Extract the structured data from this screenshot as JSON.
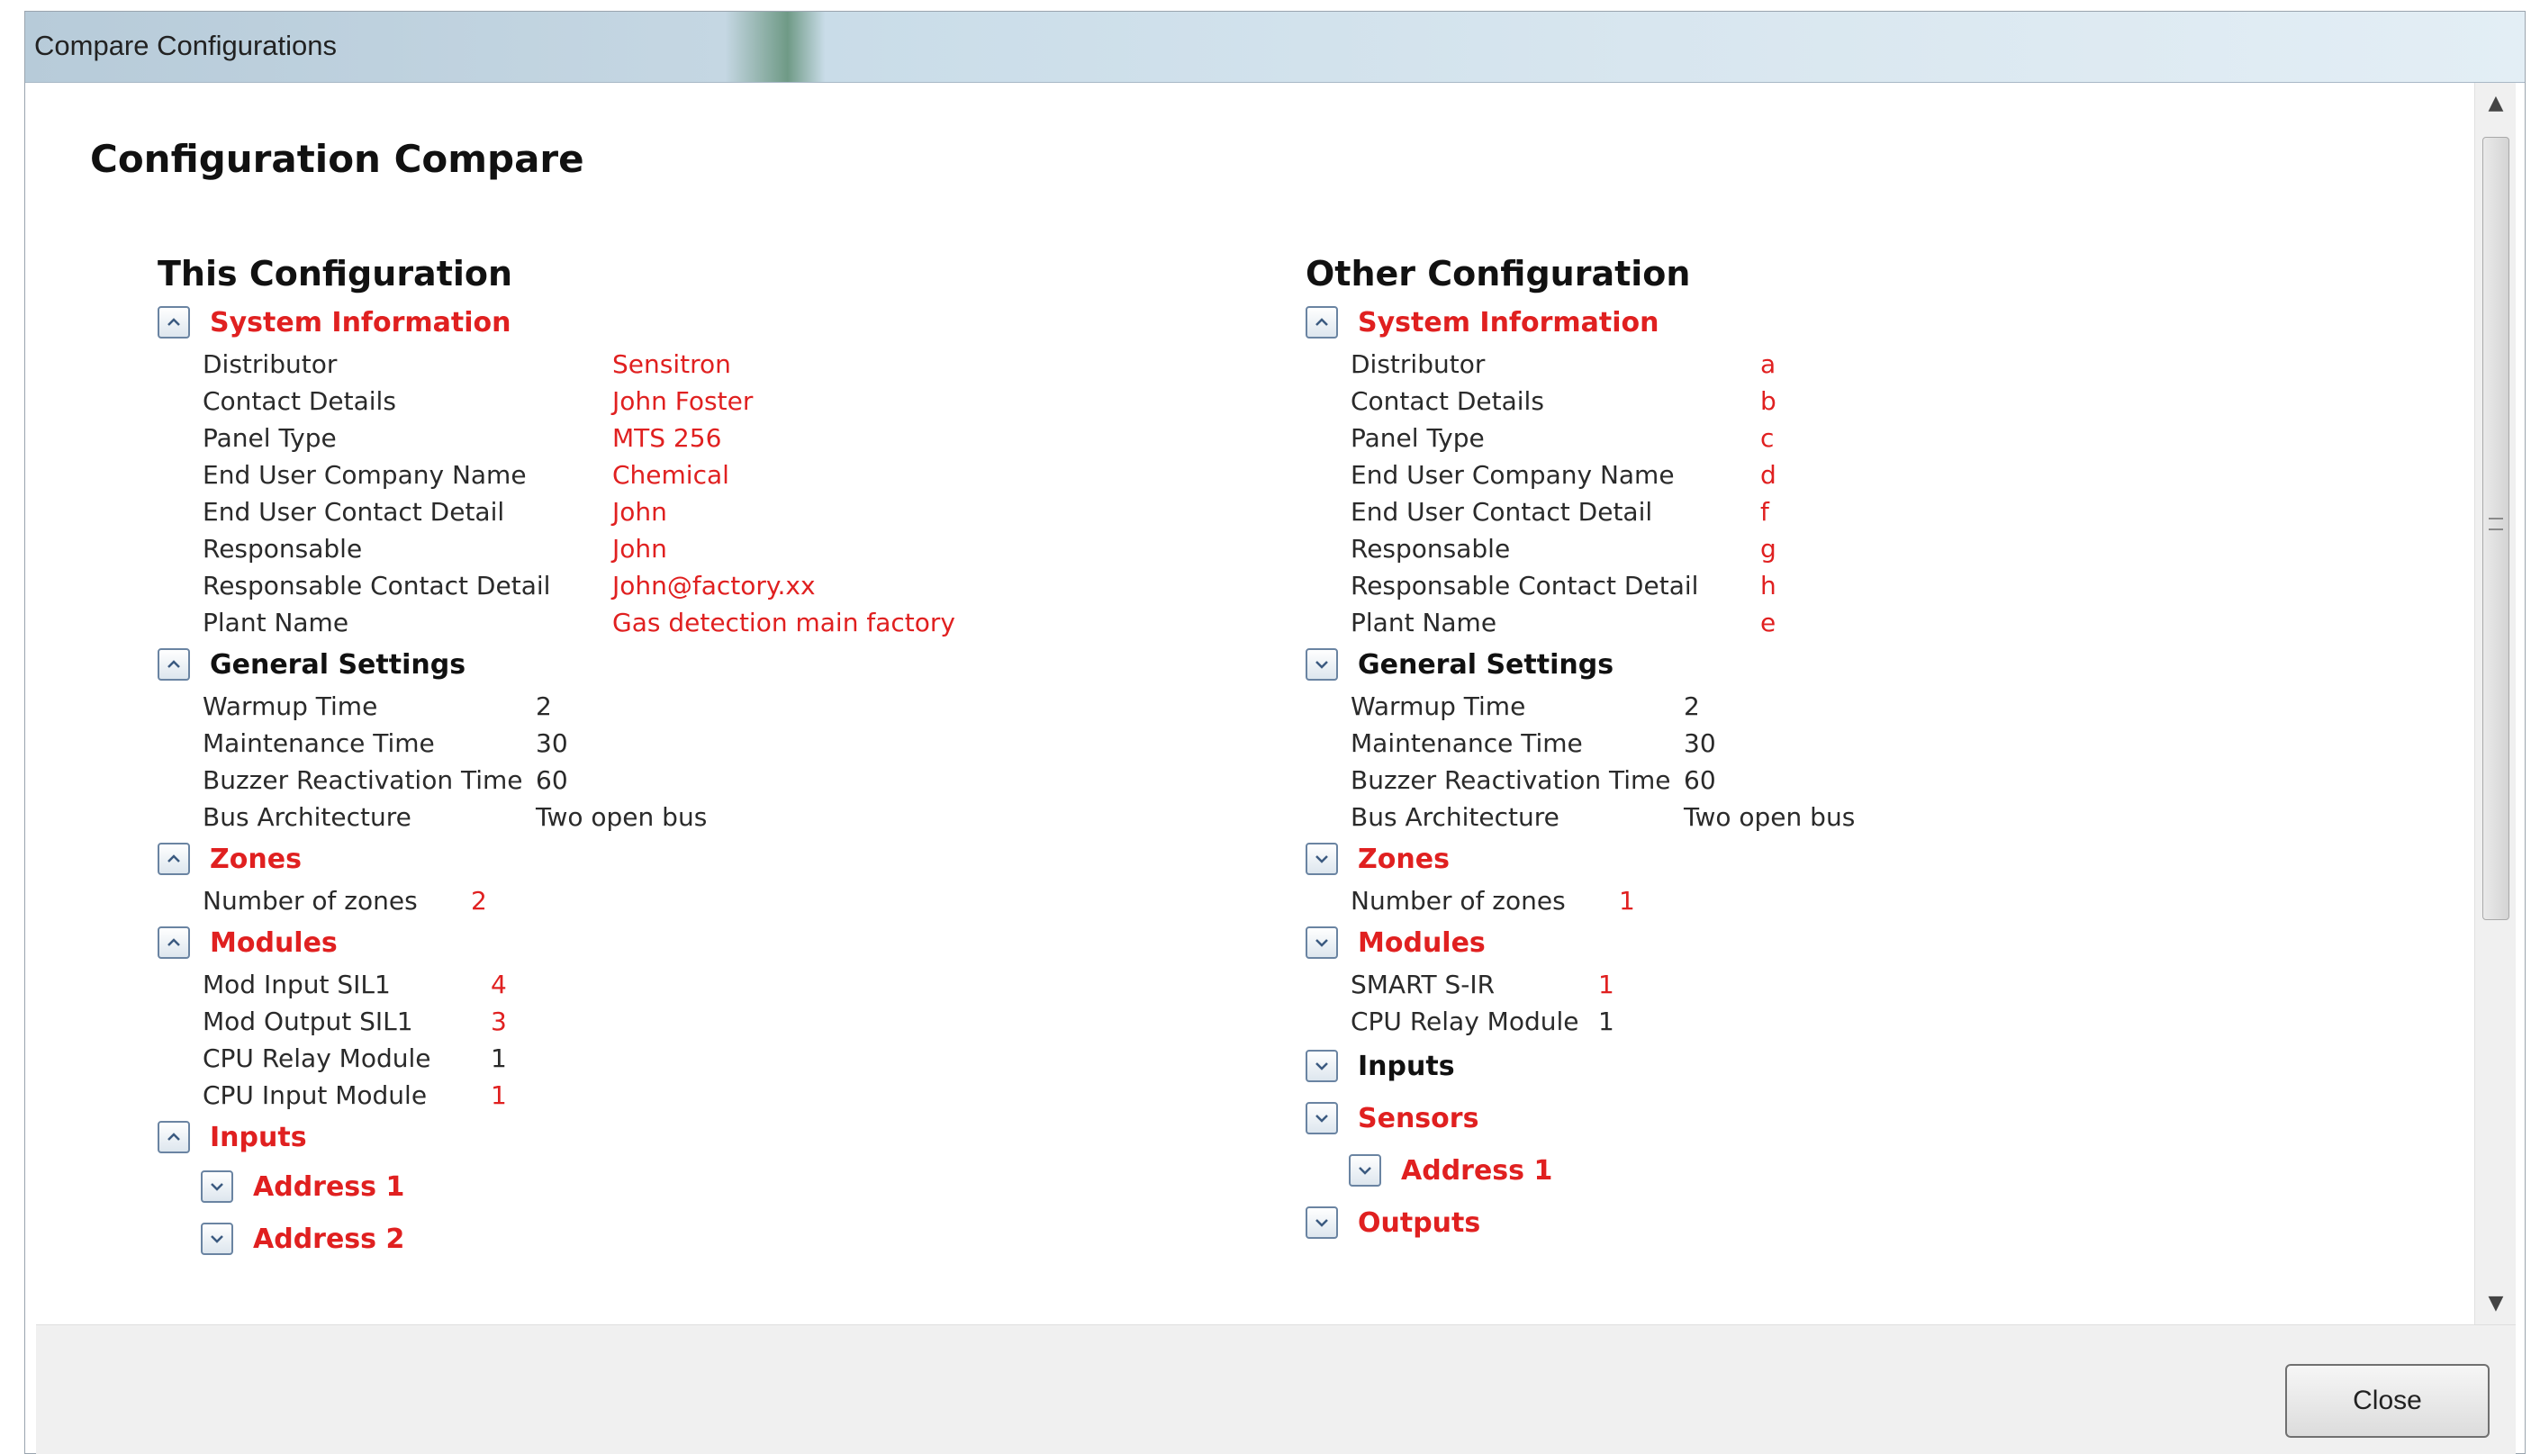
{
  "window": {
    "title": "Compare Configurations"
  },
  "page_title": "Configuration Compare",
  "left": {
    "heading": "This Configuration",
    "system_information": {
      "label": "System Information",
      "rows": [
        {
          "key": "Distributor",
          "value": "Sensitron"
        },
        {
          "key": "Contact Details",
          "value": "John Foster"
        },
        {
          "key": "Panel Type",
          "value": "MTS 256"
        },
        {
          "key": "End User Company Name",
          "value": "Chemical"
        },
        {
          "key": "End User Contact Detail",
          "value": "John"
        },
        {
          "key": "Responsable",
          "value": "John"
        },
        {
          "key": "Responsable Contact Detail",
          "value": "John@factory.xx"
        },
        {
          "key": "Plant Name",
          "value": "Gas detection main factory"
        }
      ]
    },
    "general_settings": {
      "label": "General Settings",
      "rows": [
        {
          "key": "Warmup Time",
          "value": "2"
        },
        {
          "key": "Maintenance Time",
          "value": "30"
        },
        {
          "key": "Buzzer Reactivation Time",
          "value": "60"
        },
        {
          "key": "Bus Architecture",
          "value": "Two open bus"
        }
      ]
    },
    "zones": {
      "label": "Zones",
      "rows": [
        {
          "key": "Number of zones",
          "value": "2"
        }
      ]
    },
    "modules": {
      "label": "Modules",
      "rows": [
        {
          "key": "Mod Input SIL1",
          "value": "4"
        },
        {
          "key": "Mod Output SIL1",
          "value": "3"
        },
        {
          "key": "CPU Relay Module",
          "value": "1"
        },
        {
          "key": "CPU Input Module",
          "value": "1"
        }
      ]
    },
    "inputs": {
      "label": "Inputs"
    },
    "address1": {
      "label": "Address 1"
    },
    "address2": {
      "label": "Address 2"
    }
  },
  "right": {
    "heading": "Other Configuration",
    "system_information": {
      "label": "System Information",
      "rows": [
        {
          "key": "Distributor",
          "value": "a"
        },
        {
          "key": "Contact Details",
          "value": "b"
        },
        {
          "key": "Panel Type",
          "value": "c"
        },
        {
          "key": "End User Company Name",
          "value": "d"
        },
        {
          "key": "End User Contact Detail",
          "value": "f"
        },
        {
          "key": "Responsable",
          "value": "g"
        },
        {
          "key": "Responsable Contact Detail",
          "value": "h"
        },
        {
          "key": "Plant Name",
          "value": "e"
        }
      ]
    },
    "general_settings": {
      "label": "General Settings",
      "rows": [
        {
          "key": "Warmup Time",
          "value": "2"
        },
        {
          "key": "Maintenance Time",
          "value": "30"
        },
        {
          "key": "Buzzer Reactivation Time",
          "value": "60"
        },
        {
          "key": "Bus Architecture",
          "value": "Two open bus"
        }
      ]
    },
    "zones": {
      "label": "Zones",
      "rows": [
        {
          "key": "Number of zones",
          "value": "1"
        }
      ]
    },
    "modules": {
      "label": "Modules",
      "rows": [
        {
          "key": "SMART S-IR",
          "value": "1"
        },
        {
          "key": "CPU Relay Module",
          "value": "1"
        }
      ]
    },
    "inputs": {
      "label": "Inputs"
    },
    "sensors": {
      "label": "Sensors"
    },
    "address1": {
      "label": "Address 1"
    },
    "outputs": {
      "label": "Outputs"
    }
  },
  "footer": {
    "close_label": "Close"
  },
  "colors": {
    "diff": "#e02020",
    "normal": "#2a2a2a",
    "toggle_border": "#6a84a2"
  },
  "icons": {
    "expanded": "chevron-up-icon",
    "collapsed": "chevron-down-icon"
  }
}
